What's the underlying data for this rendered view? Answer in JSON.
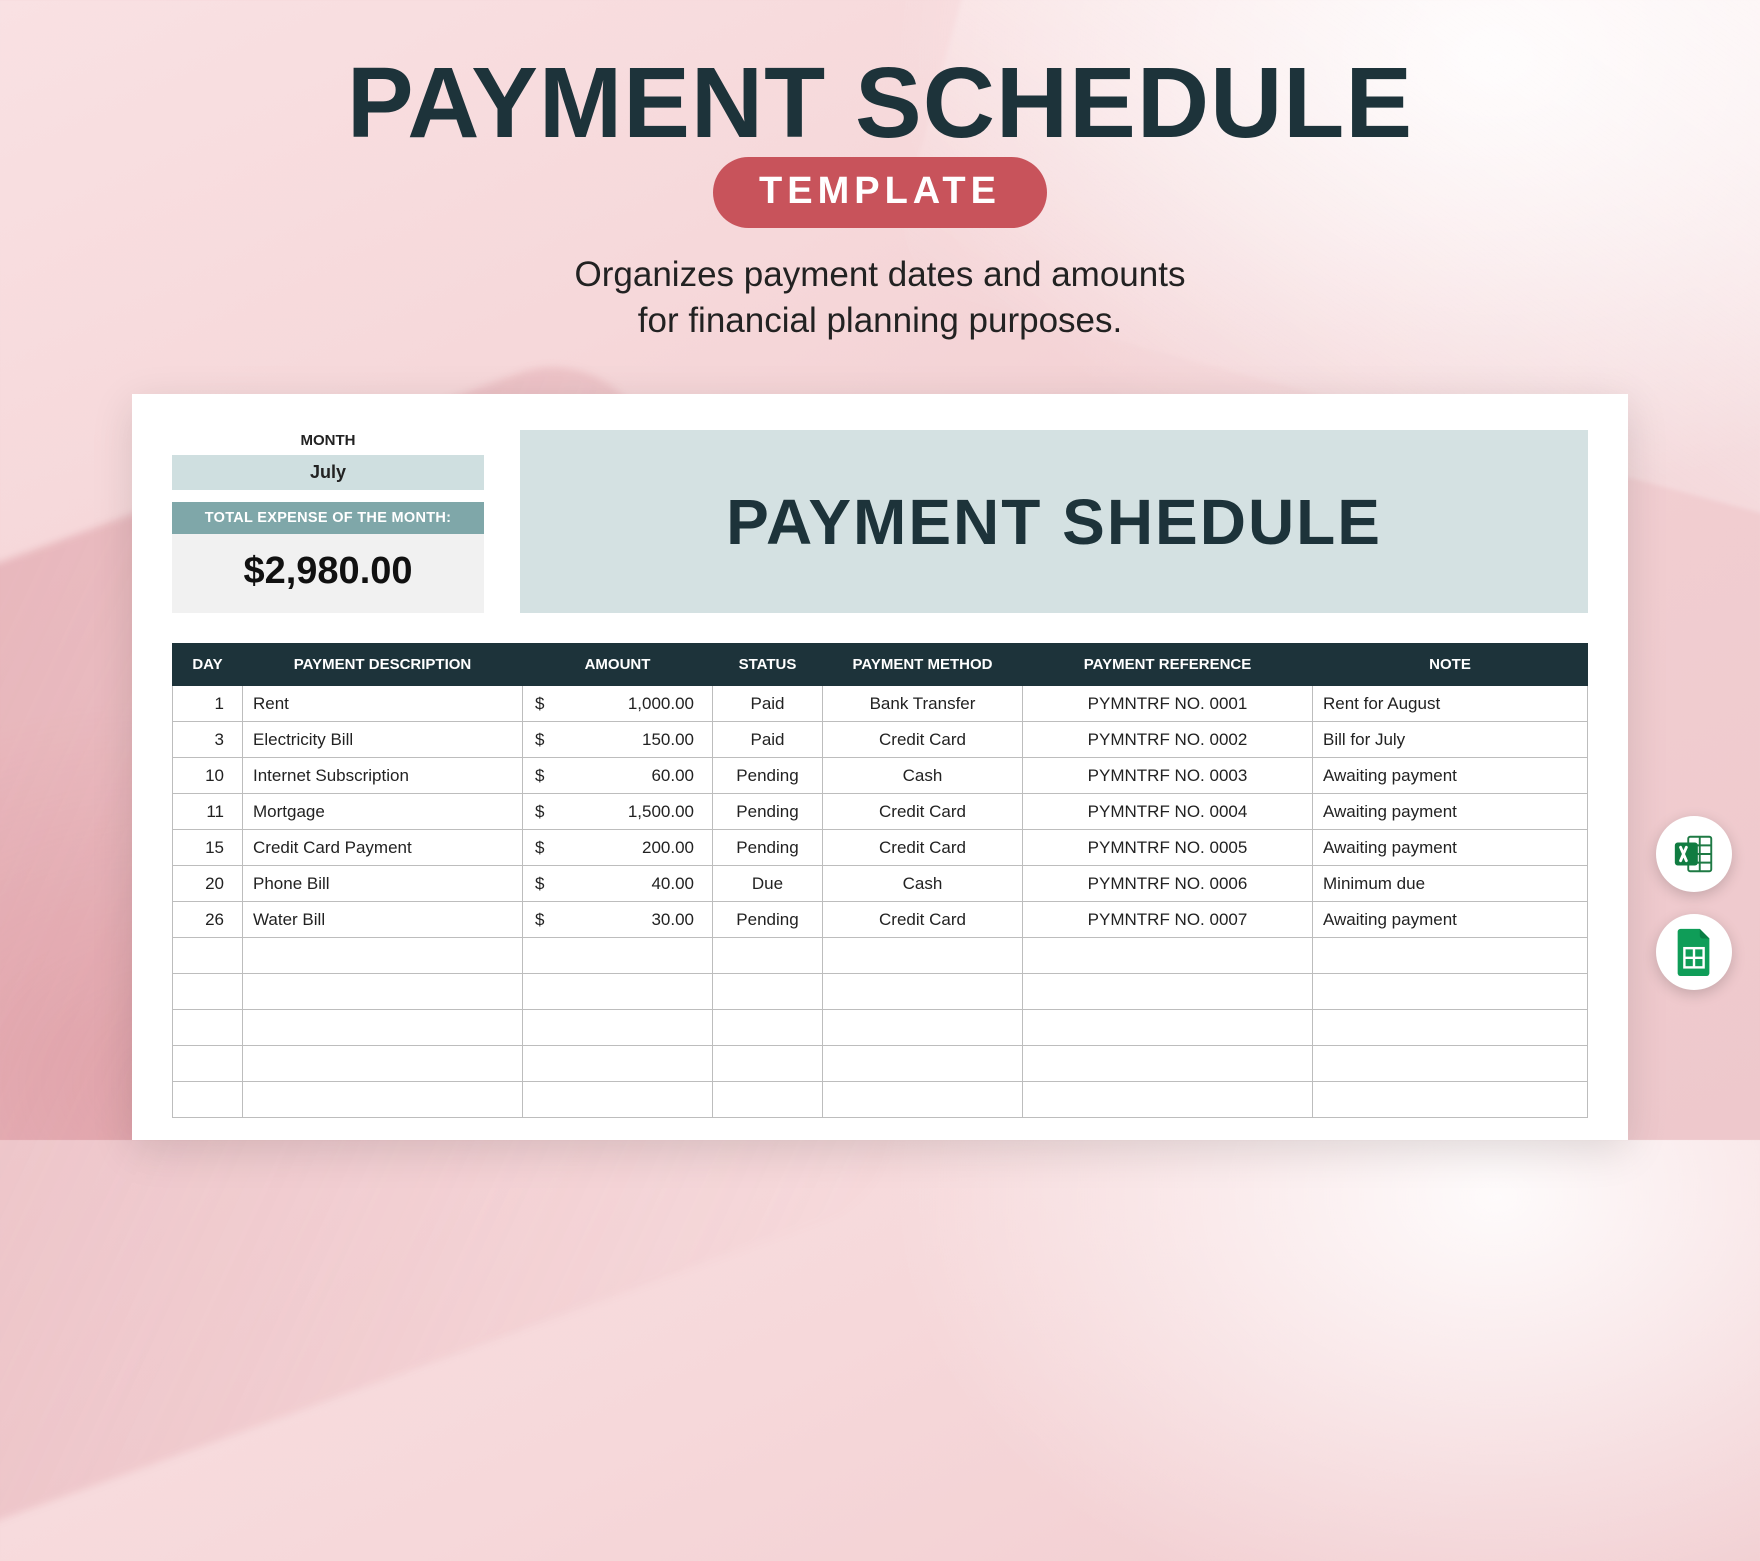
{
  "header": {
    "title": "PAYMENT SCHEDULE",
    "pill": "TEMPLATE",
    "subtitle_line1": "Organizes payment dates and amounts",
    "subtitle_line2": "for financial planning purposes."
  },
  "summary": {
    "month_label": "MONTH",
    "month_value": "July",
    "total_label": "TOTAL EXPENSE OF THE MONTH:",
    "total_value": "$2,980.00"
  },
  "banner": {
    "text": "PAYMENT SHEDULE"
  },
  "table": {
    "headers": {
      "day": "DAY",
      "desc": "PAYMENT DESCRIPTION",
      "amount": "AMOUNT",
      "status": "STATUS",
      "method": "PAYMENT METHOD",
      "ref": "PAYMENT REFERENCE",
      "note": "NOTE"
    },
    "currency": "$",
    "rows": [
      {
        "day": "1",
        "desc": "Rent",
        "amount": "1,000.00",
        "status": "Paid",
        "method": "Bank Transfer",
        "ref": "PYMNTRF NO. 0001",
        "note": "Rent for August"
      },
      {
        "day": "3",
        "desc": "Electricity Bill",
        "amount": "150.00",
        "status": "Paid",
        "method": "Credit Card",
        "ref": "PYMNTRF NO. 0002",
        "note": "Bill for July"
      },
      {
        "day": "10",
        "desc": "Internet Subscription",
        "amount": "60.00",
        "status": "Pending",
        "method": "Cash",
        "ref": "PYMNTRF NO. 0003",
        "note": "Awaiting payment"
      },
      {
        "day": "11",
        "desc": "Mortgage",
        "amount": "1,500.00",
        "status": "Pending",
        "method": "Credit Card",
        "ref": "PYMNTRF NO. 0004",
        "note": "Awaiting payment"
      },
      {
        "day": "15",
        "desc": "Credit Card Payment",
        "amount": "200.00",
        "status": "Pending",
        "method": "Credit Card",
        "ref": "PYMNTRF NO. 0005",
        "note": "Awaiting payment"
      },
      {
        "day": "20",
        "desc": "Phone Bill",
        "amount": "40.00",
        "status": "Due",
        "method": "Cash",
        "ref": "PYMNTRF NO. 0006",
        "note": "Minimum due"
      },
      {
        "day": "26",
        "desc": "Water Bill",
        "amount": "30.00",
        "status": "Pending",
        "method": "Credit Card",
        "ref": "PYMNTRF NO. 0007",
        "note": "Awaiting payment"
      }
    ],
    "empty_rows": 5
  },
  "icons": {
    "excel": "excel-icon",
    "sheets": "google-sheets-icon"
  }
}
